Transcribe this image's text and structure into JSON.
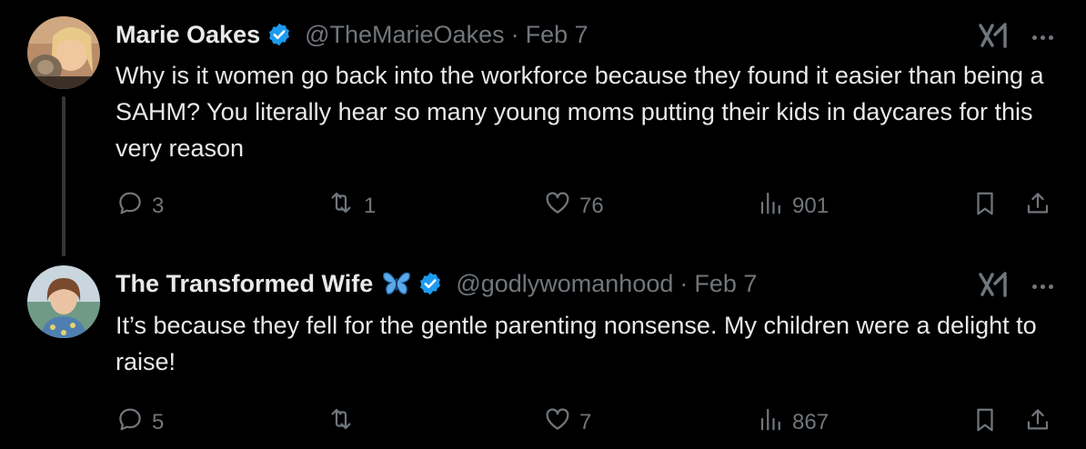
{
  "colors": {
    "background": "#000000",
    "text": "#e7e9ea",
    "secondary": "#71767b",
    "verified": "#1d9bf0",
    "thread_line": "#333639"
  },
  "tweets": [
    {
      "name": "Marie Oakes",
      "handle": "@TheMarieOakes",
      "separator": "·",
      "date": "Feb 7",
      "verified": true,
      "text": "Why is it women go back into the workforce because they found it easier than being a SAHM? You literally hear so many young moms putting their kids in daycares for this very reason",
      "replies": "3",
      "retweets": "1",
      "likes": "76",
      "views": "901",
      "icons": [
        "grok-icon",
        "more-icon",
        "reply-icon",
        "retweet-icon",
        "like-icon",
        "views-icon",
        "bookmark-icon",
        "share-icon"
      ]
    },
    {
      "name": "The Transformed Wife",
      "handle": "@godlywomanhood",
      "separator": "·",
      "date": "Feb 7",
      "verified": true,
      "name_emoji": "butterfly-icon",
      "text": "It’s because they fell for the gentle parenting nonsense. My children were a delight to raise!",
      "replies": "5",
      "retweets": "",
      "likes": "7",
      "views": "867",
      "icons": [
        "grok-icon",
        "more-icon",
        "reply-icon",
        "retweet-icon",
        "like-icon",
        "views-icon",
        "bookmark-icon",
        "share-icon"
      ]
    }
  ]
}
